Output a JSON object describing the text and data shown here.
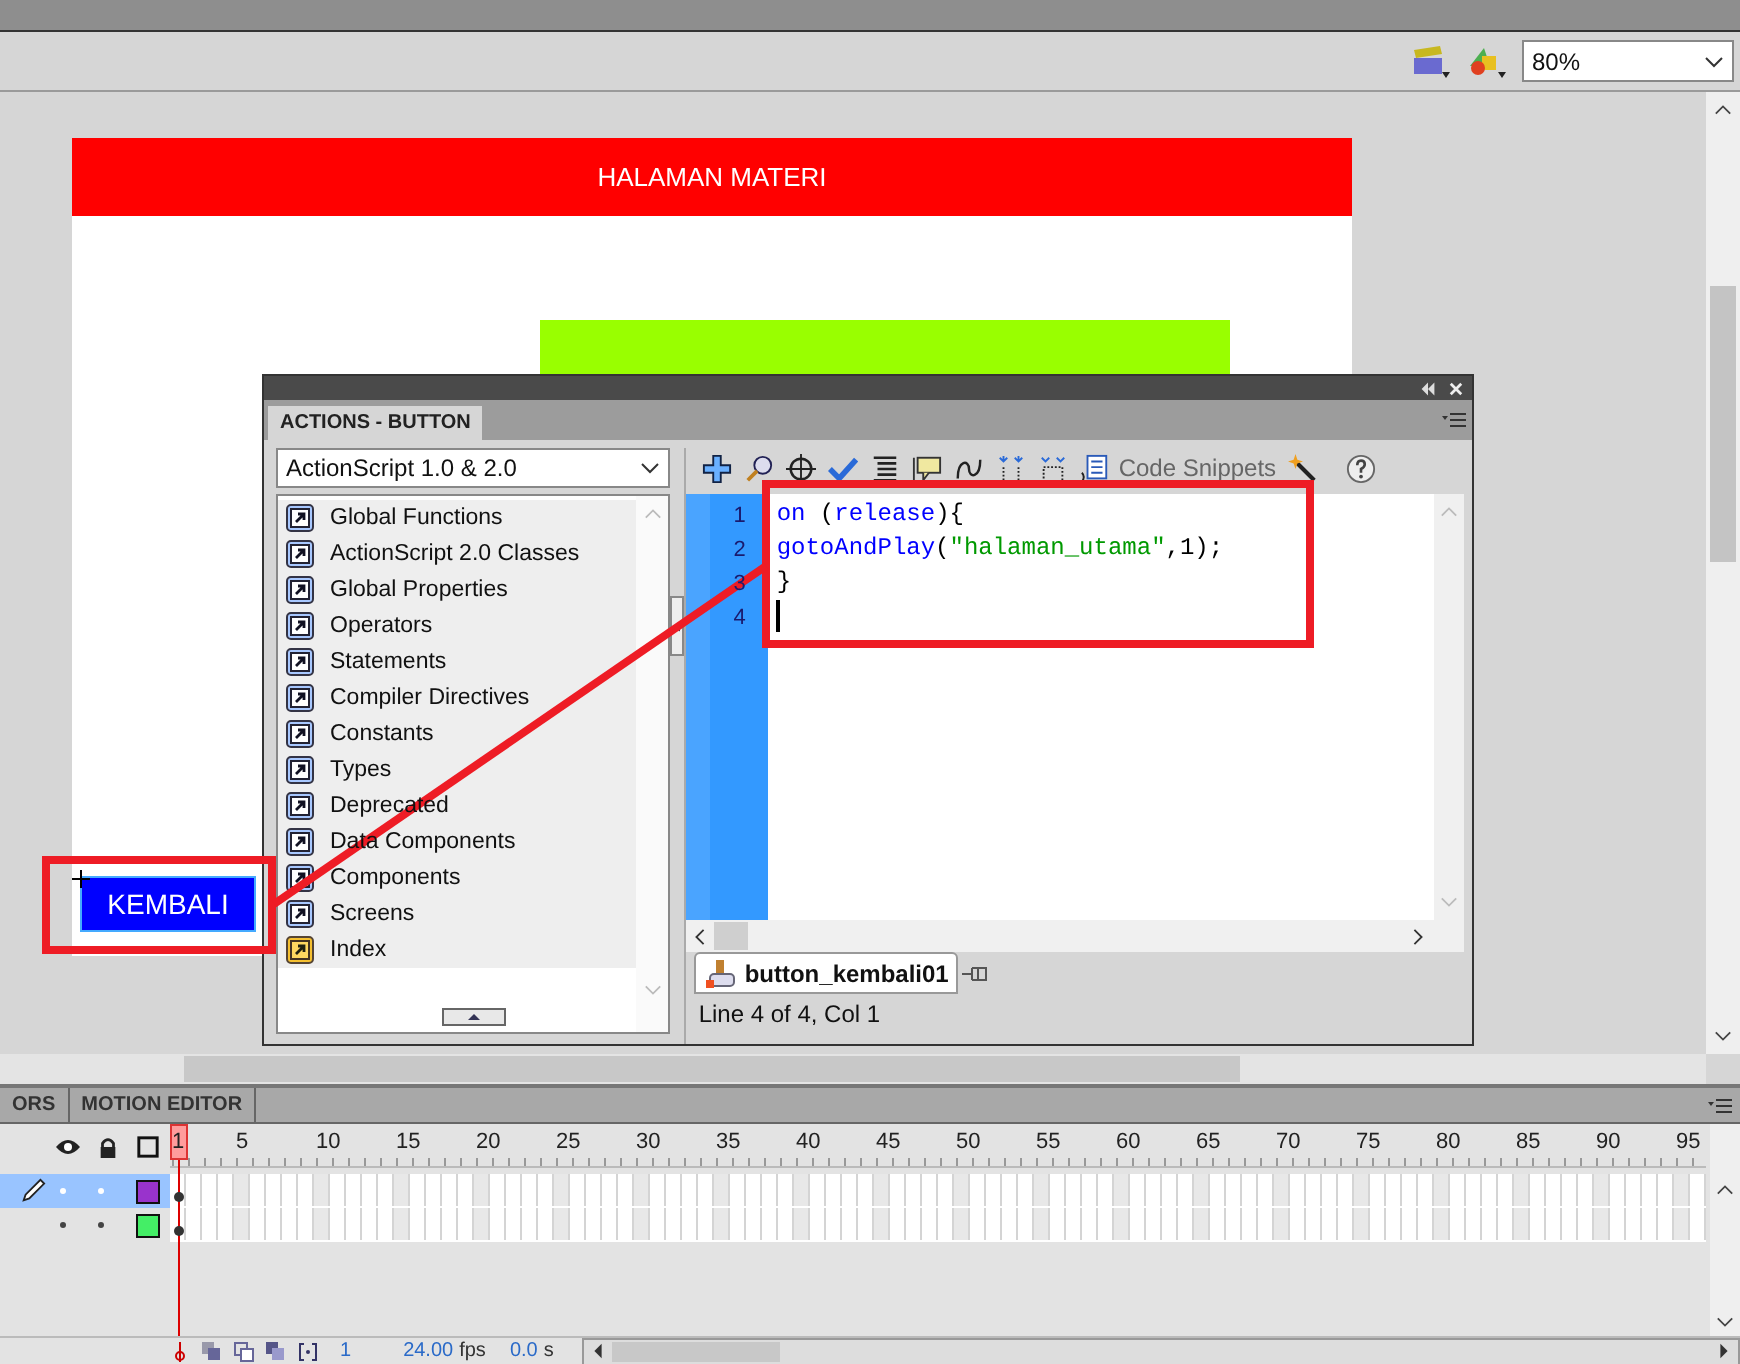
{
  "toolbar": {
    "zoom": "80%"
  },
  "stage": {
    "header": "HALAMAN MATERI",
    "button": "KEMBALI"
  },
  "actions_panel": {
    "tab": "ACTIONS - BUTTON",
    "version": "ActionScript 1.0 & 2.0",
    "categories": [
      {
        "label": "Global Functions",
        "kind": "book"
      },
      {
        "label": "ActionScript 2.0 Classes",
        "kind": "book"
      },
      {
        "label": "Global Properties",
        "kind": "book"
      },
      {
        "label": "Operators",
        "kind": "book"
      },
      {
        "label": "Statements",
        "kind": "book"
      },
      {
        "label": "Compiler Directives",
        "kind": "book"
      },
      {
        "label": "Constants",
        "kind": "book"
      },
      {
        "label": "Types",
        "kind": "book"
      },
      {
        "label": "Deprecated",
        "kind": "book"
      },
      {
        "label": "Data Components",
        "kind": "book"
      },
      {
        "label": "Components",
        "kind": "book"
      },
      {
        "label": "Screens",
        "kind": "book"
      },
      {
        "label": "Index",
        "kind": "index"
      }
    ],
    "snippets_label": "Code Snippets",
    "line_numbers": [
      "1",
      "2",
      "3",
      "4"
    ],
    "code_lines": [
      [
        {
          "text": "on",
          "kind": "keyword"
        },
        {
          "text": " (",
          "kind": "plain"
        },
        {
          "text": "release",
          "kind": "keyword"
        },
        {
          "text": "){",
          "kind": "plain"
        }
      ],
      [
        {
          "text": "gotoAndPlay",
          "kind": "keyword"
        },
        {
          "text": "(",
          "kind": "plain"
        },
        {
          "text": "\"halaman_utama\"",
          "kind": "string"
        },
        {
          "text": ",1);",
          "kind": "plain"
        }
      ],
      [
        {
          "text": "}",
          "kind": "plain"
        }
      ]
    ],
    "file_tab": "button_kembali01",
    "status": "Line 4 of 4, Col 1"
  },
  "timeline": {
    "tabs": [
      {
        "label": "ORS",
        "selected": false
      },
      {
        "label": "MOTION EDITOR",
        "selected": false
      }
    ],
    "frame_numbers": [
      "1",
      "5",
      "10",
      "15",
      "20",
      "25",
      "30",
      "35",
      "40",
      "45",
      "50",
      "55",
      "60",
      "65",
      "70",
      "75",
      "80",
      "85",
      "90",
      "95"
    ],
    "layers": [
      {
        "selected": true,
        "color": "#9933cc"
      },
      {
        "selected": false,
        "color": "#44ee66"
      }
    ],
    "footer": {
      "frame": "1",
      "fps": "24.00",
      "fps_unit": "fps",
      "time": "0.0",
      "time_unit": "s"
    }
  }
}
